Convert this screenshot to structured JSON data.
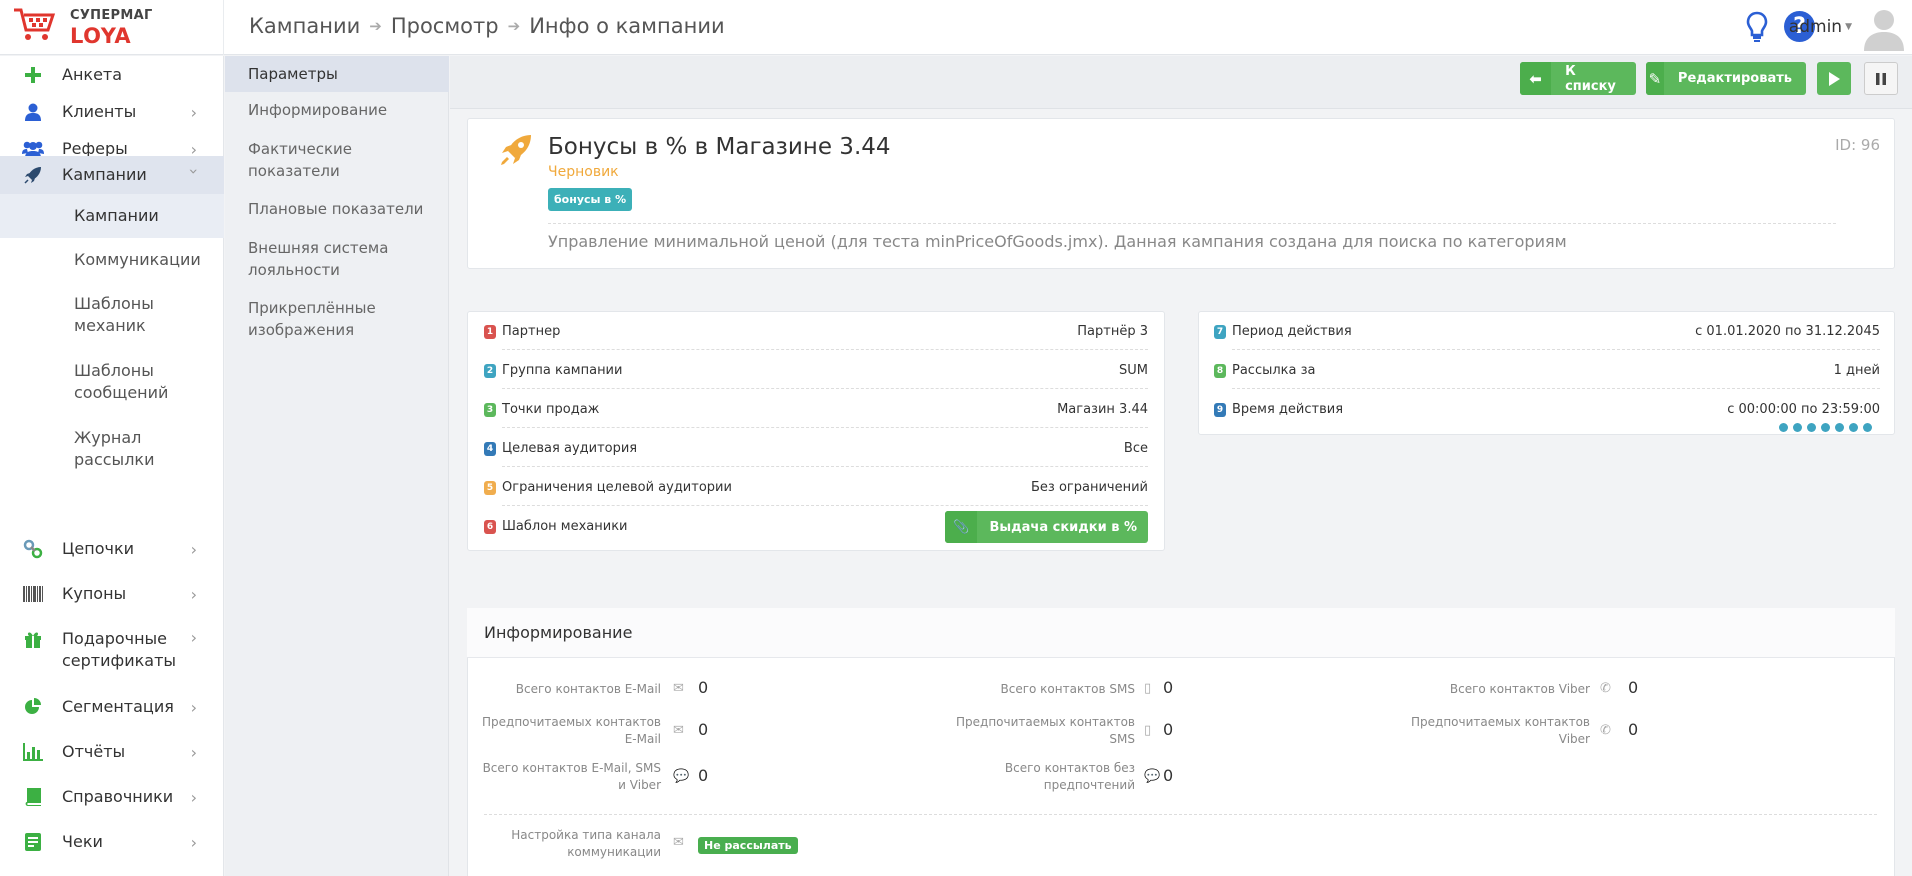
{
  "app": {
    "brand_top": "СУПЕРМАГ",
    "brand_bottom": "LOYA"
  },
  "breadcrumbs": [
    "Кампании",
    "Просмотр",
    "Инфо о кампании"
  ],
  "user": {
    "name": "admin"
  },
  "sidebar": {
    "items": [
      {
        "label": "Анкета",
        "icon": "plus-icon"
      },
      {
        "label": "Клиенты",
        "icon": "user-icon"
      },
      {
        "label": "Реферы",
        "icon": "users-icon"
      },
      {
        "label": "Кампании",
        "icon": "rocket-icon"
      },
      {
        "label": "Цепочки",
        "icon": "link-icon"
      },
      {
        "label": "Купоны",
        "icon": "barcode-icon"
      },
      {
        "label": "Подарочные сертификаты",
        "icon": "gift-icon"
      },
      {
        "label": "Сегментация",
        "icon": "pie-chart-icon"
      },
      {
        "label": "Отчёты",
        "icon": "bar-chart-icon"
      },
      {
        "label": "Справочники",
        "icon": "book-icon"
      },
      {
        "label": "Чеки",
        "icon": "receipt-icon"
      }
    ],
    "subitems": [
      "Кампании",
      "Коммуникации",
      "Шаблоны механик",
      "Шаблоны сообщений",
      "Журнал рассылки"
    ]
  },
  "section_nav": [
    "Параметры",
    "Информирование",
    "Фактические показатели",
    "Плановые показатели",
    "Внешняя система лояльности",
    "Прикреплённые изображения"
  ],
  "toolbar": {
    "back_label": "К списку",
    "edit_label": "Редактировать"
  },
  "campaign": {
    "title": "Бонусы в % в Магазине 3.44",
    "status": "Черновик",
    "tag": "бонусы в %",
    "id": "ID: 96",
    "description": "Управление минимальной ценой (для теста minPriceOfGoods.jmx). Данная кампания создана для поиска по категориям"
  },
  "params_left": [
    {
      "n": "1",
      "color": "#d9534f",
      "label": "Партнер",
      "value": "Партнёр 3"
    },
    {
      "n": "2",
      "color": "#3ea4c1",
      "label": "Группа кампании",
      "value": "SUM"
    },
    {
      "n": "3",
      "color": "#5cb85c",
      "label": "Точки продаж",
      "value": "Магазин 3.44"
    },
    {
      "n": "4",
      "color": "#337ab7",
      "label": "Целевая аудитория",
      "value": "Все"
    },
    {
      "n": "5",
      "color": "#f0ad4e",
      "label": "Ограничения целевой аудитории",
      "value": "Без ограничений"
    },
    {
      "n": "6",
      "color": "#d9534f",
      "label": "Шаблон механики",
      "value": "Выдача скидки в %"
    }
  ],
  "params_right": [
    {
      "n": "7",
      "color": "#3ea4c1",
      "label": "Период действия",
      "value": "с 01.01.2020 по 31.12.2045"
    },
    {
      "n": "8",
      "color": "#5cb85c",
      "label": "Рассылка за",
      "value": "1 дней"
    },
    {
      "n": "9",
      "color": "#337ab7",
      "label": "Время действия",
      "value": "с 00:00:00 по 23:59:00"
    }
  ],
  "informing": {
    "title": "Информирование",
    "stats": [
      {
        "label": "Всего контактов E-Mail",
        "value": "0",
        "icon": "envelope-icon"
      },
      {
        "label": "Предпочитаемых контактов E-Mail",
        "value": "0",
        "icon": "envelope-icon"
      },
      {
        "label": "Всего контактов E-Mail, SMS и Viber",
        "value": "0",
        "icon": "chat-icon"
      },
      {
        "label": "Всего контактов SMS",
        "value": "0",
        "icon": "phone-icon"
      },
      {
        "label": "Предпочитаемых контактов SMS",
        "value": "0",
        "icon": "phone-icon"
      },
      {
        "label": "Всего контактов без предпочтений",
        "value": "0",
        "icon": "chat-icon"
      },
      {
        "label": "Всего контактов Viber",
        "value": "0",
        "icon": "viber-icon"
      },
      {
        "label": "Предпочитаемых контактов Viber",
        "value": "0",
        "icon": "viber-icon"
      }
    ],
    "channel_label": "Настройка типа канала коммуникации",
    "channel_value": "Не рассылать"
  }
}
